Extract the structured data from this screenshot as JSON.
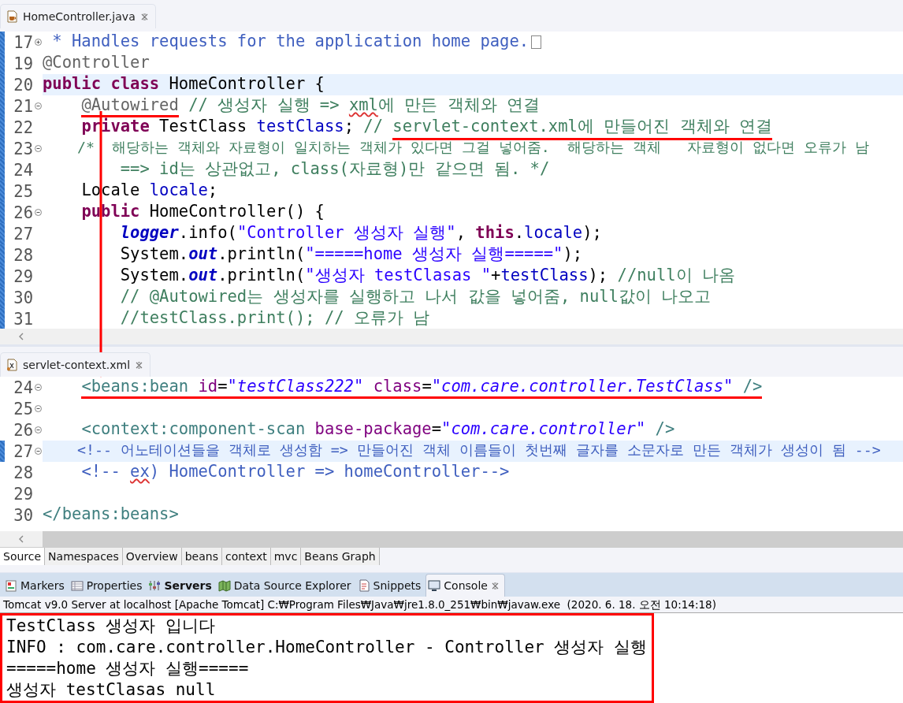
{
  "java_editor": {
    "tab": {
      "title": "HomeController.java",
      "selected": true
    },
    "lines": [
      {
        "number": "17",
        "foldable": true,
        "collapsed": true,
        "changed": true,
        "current": false,
        "folded_marker": true,
        "segments": [
          {
            "marked": false,
            "tokens": [
              {
                "kind": "doc",
                "text": " * Handles requests for the application home page."
              }
            ]
          }
        ]
      },
      {
        "number": "19",
        "foldable": false,
        "changed": true,
        "current": false,
        "folded_marker": false,
        "segments": [
          {
            "marked": false,
            "tokens": [
              {
                "kind": "annotation",
                "text": "@Controller"
              }
            ]
          }
        ]
      },
      {
        "number": "20",
        "foldable": false,
        "changed": true,
        "current": true,
        "folded_marker": false,
        "segments": [
          {
            "marked": false,
            "tokens": [
              {
                "kind": "keyword",
                "text": "public"
              },
              {
                "kind": "keyword",
                "text": " class"
              },
              {
                "kind": "plain",
                "text": " HomeController {"
              }
            ]
          }
        ]
      },
      {
        "number": "21",
        "foldable": true,
        "collapsed": false,
        "changed": true,
        "current": false,
        "folded_marker": false,
        "segments": [
          {
            "marked": true,
            "tokens": [
              {
                "kind": "annotation",
                "text": "    @Autowired"
              }
            ]
          },
          {
            "marked": false,
            "tokens": [
              {
                "kind": "comment",
                "text": " // 생성자 실행 => "
              },
              {
                "kind": "comment-typo",
                "text": "xml"
              },
              {
                "kind": "comment",
                "text": "에 만든 객체와 연결"
              }
            ]
          }
        ]
      },
      {
        "number": "22",
        "foldable": false,
        "changed": true,
        "current": false,
        "folded_marker": false,
        "segments": [
          {
            "marked": false,
            "tokens": [
              {
                "kind": "keyword",
                "text": "    private"
              },
              {
                "kind": "plain",
                "text": " TestClass "
              },
              {
                "kind": "field",
                "text": "testClass"
              },
              {
                "kind": "plain",
                "text": "; "
              },
              {
                "kind": "comment",
                "text": "// "
              }
            ]
          },
          {
            "marked": true,
            "tokens": [
              {
                "kind": "comment",
                "text": "servlet-context.xml에 만들어진 객체와 연결"
              }
            ]
          }
        ]
      },
      {
        "number": "23",
        "foldable": true,
        "collapsed": false,
        "changed": true,
        "current": false,
        "folded_marker": false,
        "segments": [
          {
            "marked": false,
            "tokens": [
              {
                "kind": "comment",
                "text": "    /*  해당하는 객체와 자료형이 일치하는 객체가 있다면 그걸 넣어줌.  해당하는 객체   자료형이 없다면 오류가 남"
              }
            ]
          }
        ]
      },
      {
        "number": "24",
        "foldable": false,
        "changed": true,
        "current": false,
        "folded_marker": false,
        "segments": [
          {
            "marked": false,
            "tokens": [
              {
                "kind": "comment",
                "text": "        ==> id는 상관없고, class(자료형)만 같으면 됨. */"
              }
            ]
          }
        ]
      },
      {
        "number": "25",
        "foldable": false,
        "changed": true,
        "current": false,
        "folded_marker": false,
        "segments": [
          {
            "marked": false,
            "tokens": [
              {
                "kind": "plain",
                "text": "    Locale "
              },
              {
                "kind": "field",
                "text": "locale"
              },
              {
                "kind": "plain",
                "text": ";"
              }
            ]
          }
        ]
      },
      {
        "number": "26",
        "foldable": true,
        "collapsed": false,
        "changed": true,
        "current": false,
        "folded_marker": false,
        "segments": [
          {
            "marked": false,
            "tokens": [
              {
                "kind": "keyword",
                "text": "    public"
              },
              {
                "kind": "plain",
                "text": " HomeController() {"
              }
            ]
          }
        ]
      },
      {
        "number": "27",
        "foldable": false,
        "changed": true,
        "current": false,
        "folded_marker": false,
        "segments": [
          {
            "marked": false,
            "tokens": [
              {
                "kind": "static",
                "text": "        logger"
              },
              {
                "kind": "plain",
                "text": ".info("
              },
              {
                "kind": "string",
                "text": "\"Controller 생성자 실행\""
              },
              {
                "kind": "plain",
                "text": ", "
              },
              {
                "kind": "keyword",
                "text": "this"
              },
              {
                "kind": "plain",
                "text": "."
              },
              {
                "kind": "field",
                "text": "locale"
              },
              {
                "kind": "plain",
                "text": ");"
              }
            ]
          }
        ]
      },
      {
        "number": "28",
        "foldable": false,
        "changed": true,
        "current": false,
        "folded_marker": false,
        "segments": [
          {
            "marked": false,
            "tokens": [
              {
                "kind": "plain",
                "text": "        System."
              },
              {
                "kind": "static",
                "text": "out"
              },
              {
                "kind": "plain",
                "text": ".println("
              },
              {
                "kind": "string",
                "text": "\"=====home 생성자 실행=====\""
              },
              {
                "kind": "plain",
                "text": ");"
              }
            ]
          }
        ]
      },
      {
        "number": "29",
        "foldable": false,
        "changed": true,
        "current": false,
        "folded_marker": false,
        "segments": [
          {
            "marked": false,
            "tokens": [
              {
                "kind": "plain",
                "text": "        System."
              },
              {
                "kind": "static",
                "text": "out"
              },
              {
                "kind": "plain",
                "text": ".println("
              },
              {
                "kind": "string",
                "text": "\"생성자 testClasas \""
              },
              {
                "kind": "plain",
                "text": "+"
              },
              {
                "kind": "field",
                "text": "testClass"
              },
              {
                "kind": "plain",
                "text": "); "
              },
              {
                "kind": "comment",
                "text": "//null이 나옴"
              }
            ]
          }
        ]
      },
      {
        "number": "30",
        "foldable": false,
        "changed": true,
        "current": false,
        "folded_marker": false,
        "segments": [
          {
            "marked": false,
            "tokens": [
              {
                "kind": "comment",
                "text": "        // @Autowired는 생성자를 실행하고 나서 값을 넣어줌, null값이 나오고"
              }
            ]
          }
        ]
      },
      {
        "number": "31",
        "foldable": false,
        "changed": true,
        "current": false,
        "folded_marker": false,
        "segments": [
          {
            "marked": false,
            "tokens": [
              {
                "kind": "comment",
                "text": "        //testClass.print(); // 오류가 남"
              }
            ]
          }
        ]
      }
    ]
  },
  "xml_editor": {
    "tab": {
      "title": "servlet-context.xml",
      "selected": true
    },
    "lines": [
      {
        "number": "24",
        "foldable": true,
        "collapsed": false,
        "changed": false,
        "current": false,
        "folded_marker": false,
        "segments": [
          {
            "marked": true,
            "tokens": [
              {
                "kind": "tag",
                "text": "    <beans:bean"
              },
              {
                "kind": "attribute",
                "text": " id"
              },
              {
                "kind": "plain",
                "text": "="
              },
              {
                "kind": "value",
                "text": "\"testClass222\""
              },
              {
                "kind": "attribute",
                "text": " class"
              },
              {
                "kind": "plain",
                "text": "="
              },
              {
                "kind": "value",
                "text": "\"com.care.controller.TestClass\""
              },
              {
                "kind": "tag",
                "text": " />"
              }
            ]
          }
        ]
      },
      {
        "number": "25",
        "foldable": true,
        "collapsed": false,
        "changed": false,
        "current": false,
        "folded_marker": false
      },
      {
        "number": "26",
        "foldable": true,
        "collapsed": false,
        "changed": false,
        "current": false,
        "folded_marker": false,
        "segments": [
          {
            "marked": false,
            "tokens": [
              {
                "kind": "tag",
                "text": "    <context:component-scan"
              },
              {
                "kind": "attribute",
                "text": " base-package"
              },
              {
                "kind": "plain",
                "text": "="
              },
              {
                "kind": "value",
                "text": "\"com.care.controller\""
              },
              {
                "kind": "tag",
                "text": " />"
              }
            ]
          }
        ]
      },
      {
        "number": "27",
        "foldable": true,
        "collapsed": false,
        "changed": true,
        "current": true,
        "folded_marker": false,
        "segments": [
          {
            "marked": false,
            "tokens": [
              {
                "kind": "xml-comment",
                "text": "    <!-- 어노테이션들을 객체로 생성함 => 만들어진 객체 이름들이 첫번째 글자를 소문자로 만든 객체가 생성이 됨 -->"
              }
            ]
          }
        ]
      },
      {
        "number": "28",
        "foldable": false,
        "changed": false,
        "current": false,
        "folded_marker": false,
        "segments": [
          {
            "marked": false,
            "tokens": [
              {
                "kind": "xml-comment",
                "text": "    <!-- "
              },
              {
                "kind": "xml-comment-typo",
                "text": "ex"
              },
              {
                "kind": "xml-comment",
                "text": ") HomeController => homeController-->"
              }
            ]
          }
        ]
      },
      {
        "number": "29",
        "foldable": false,
        "changed": false,
        "current": false,
        "folded_marker": false
      },
      {
        "number": "30",
        "foldable": false,
        "changed": false,
        "current": false,
        "folded_marker": false,
        "segments": [
          {
            "marked": false,
            "tokens": [
              {
                "kind": "tag",
                "text": "</beans:beans>"
              }
            ]
          }
        ]
      }
    ],
    "page_tabs": [
      {
        "label": "Source",
        "selected": true
      },
      {
        "label": "Namespaces",
        "selected": false
      },
      {
        "label": "Overview",
        "selected": false
      },
      {
        "label": "beans",
        "selected": false
      },
      {
        "label": "context",
        "selected": false
      },
      {
        "label": "mvc",
        "selected": false
      },
      {
        "label": "Beans Graph",
        "selected": false
      }
    ]
  },
  "views": {
    "tabs": [
      {
        "label": "Markers",
        "selected": false,
        "bold": false
      },
      {
        "label": "Properties",
        "selected": false,
        "bold": false
      },
      {
        "label": "Servers",
        "selected": false,
        "bold": true
      },
      {
        "label": "Data Source Explorer",
        "selected": false,
        "bold": false
      },
      {
        "label": "Snippets",
        "selected": false,
        "bold": false
      },
      {
        "label": "Console",
        "selected": true,
        "bold": false
      }
    ]
  },
  "console": {
    "process": "Tomcat v9.0 Server at localhost [Apache Tomcat] C:₩Program Files₩Java₩jre1.8.0_251₩bin₩javaw.exe  (2020. 6. 18. 오전 10:14:18)",
    "boxed": true,
    "lines": [
      "TestClass 생성자 입니다",
      "INFO : com.care.controller.HomeController - Controller 생성자 실행",
      "=====home 생성자 실행=====",
      "생성자 testClasas null"
    ]
  }
}
